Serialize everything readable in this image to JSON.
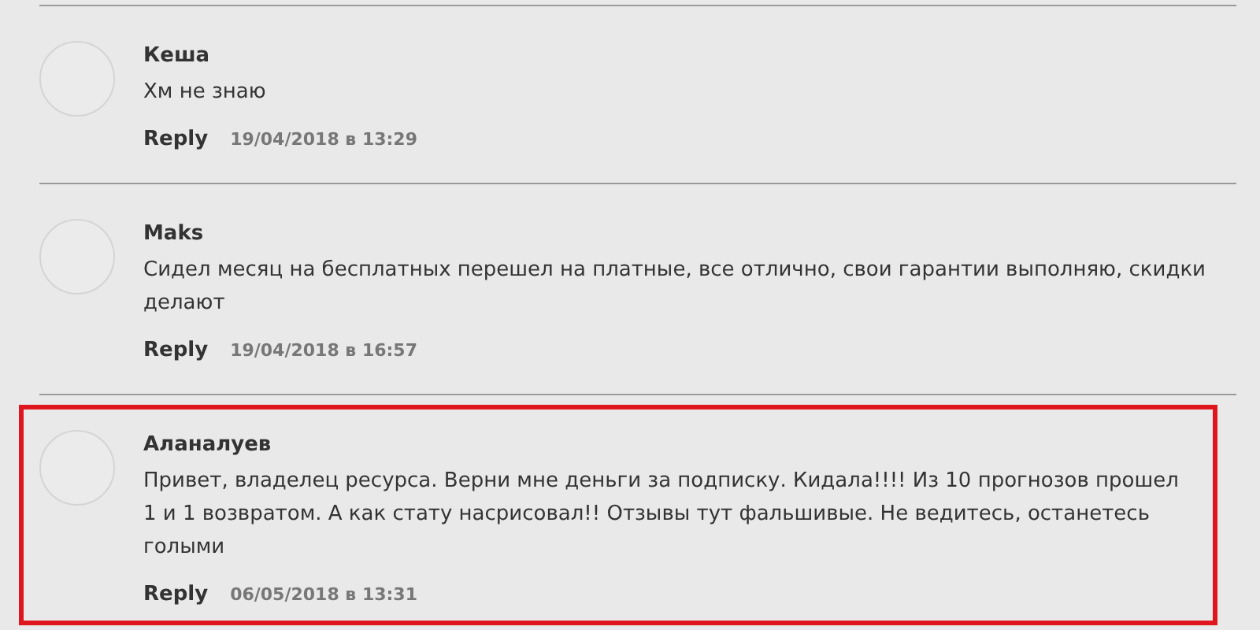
{
  "comments": [
    {
      "author": "Кеша",
      "text": "Хм не знаю",
      "reply": "Reply",
      "date": "19/04/2018 в 13:29",
      "highlighted": false
    },
    {
      "author": "Maks",
      "text": "Сидел месяц на бесплатных перешел на платные, все отлично, свои гарантии выполняю, скидки делают",
      "reply": "Reply",
      "date": "19/04/2018 в 16:57",
      "highlighted": false
    },
    {
      "author": "Аланалуев",
      "text": "Привет, владелец ресурса. Верни мне деньги за подписку. Кидала!!!! Из 10 прогнозов прошел 1 и 1 возвратом. А как стату насрисовал!! Отзывы тут фальшивые. Не ведитесь, останетесь голыми",
      "reply": "Reply",
      "date": "06/05/2018 в 13:31",
      "highlighted": true
    }
  ]
}
